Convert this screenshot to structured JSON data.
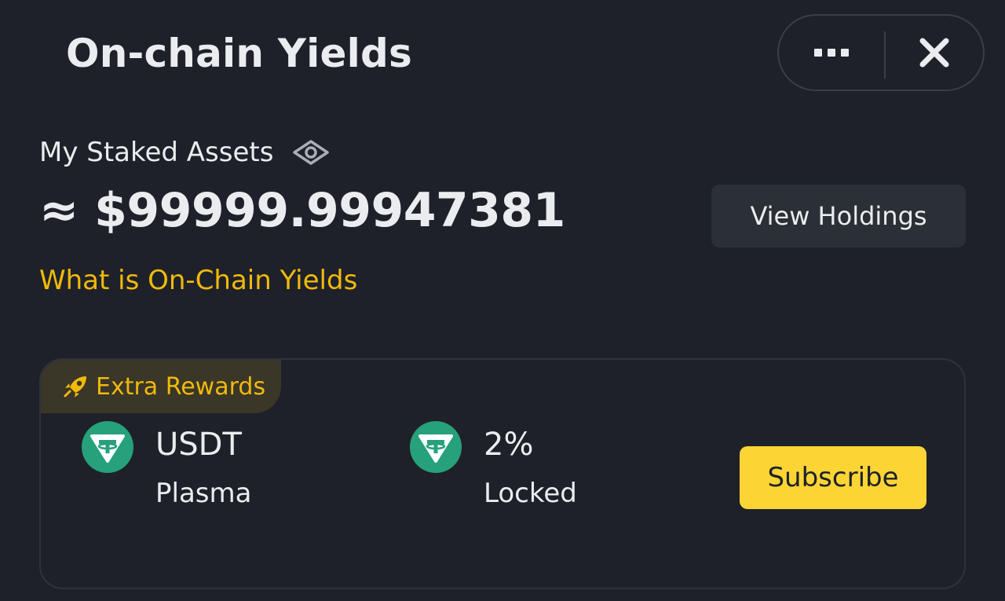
{
  "header": {
    "title": "On-chain Yields",
    "more_icon": "more-horizontal-icon",
    "close_icon": "close-icon"
  },
  "summary": {
    "staked_label": "My Staked Assets",
    "visibility_icon": "eye-icon",
    "amount": "≈ $99999.99947381",
    "view_holdings_label": "View Holdings",
    "info_link": "What is On-Chain Yields"
  },
  "card": {
    "tag_icon": "rocket-icon",
    "tag_label": "Extra Rewards",
    "asset": {
      "icon": "tether-icon",
      "symbol": "USDT",
      "network": "Plasma"
    },
    "apr": {
      "icon": "tether-icon",
      "value": "2%",
      "term": "Locked"
    },
    "subscribe_label": "Subscribe"
  },
  "colors": {
    "background": "#1e2129",
    "accent": "#f0b90b",
    "button_primary": "#fcd535",
    "button_secondary": "#2b2f36",
    "tether": "#26a17b"
  }
}
